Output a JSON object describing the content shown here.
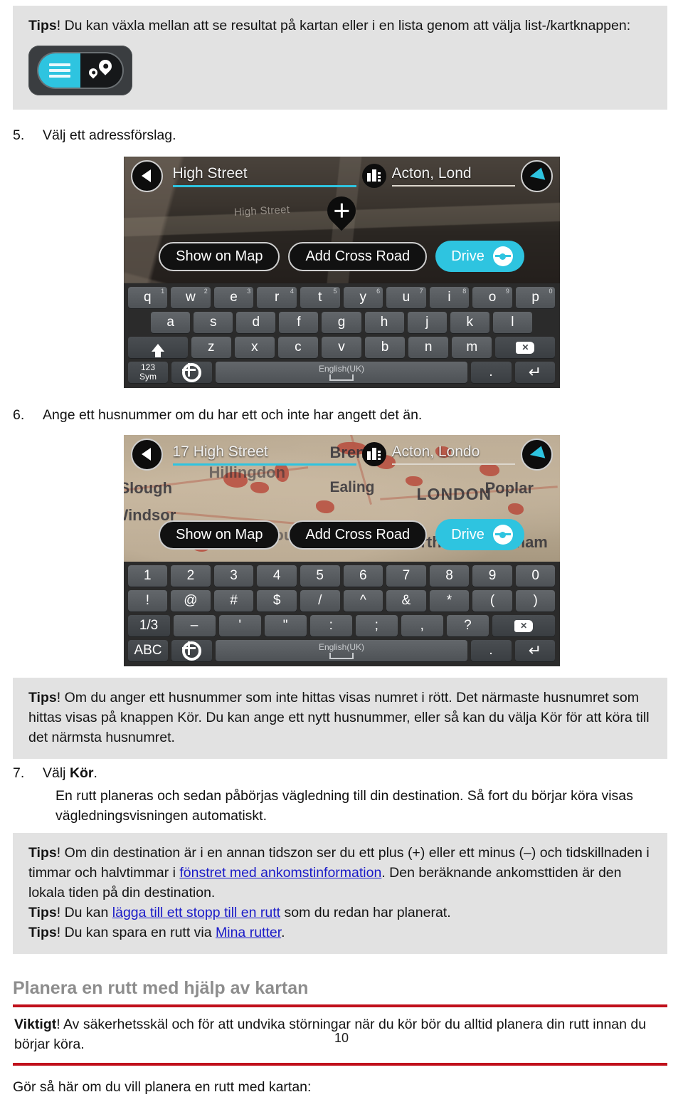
{
  "tip_top": {
    "label": "Tips",
    "text": "! Du kan växla mellan att se resultat på kartan eller i en lista genom att välja list-/kartknappen:"
  },
  "steps": {
    "step5": {
      "num": "5.",
      "text": "Välj ett adressförslag."
    },
    "step6": {
      "num": "6.",
      "text": "Ange ett husnummer om du har ett och inte har angett det än."
    },
    "step7": {
      "num": "7.",
      "text_pre": "Välj ",
      "bold": "Kör",
      "text_post": "."
    }
  },
  "device1": {
    "address": "High Street",
    "city": "Acton, Lond",
    "map_label": "High Street",
    "buttons": {
      "show_on_map": "Show on Map",
      "add_cross_road": "Add Cross Road",
      "drive": "Drive"
    },
    "keyboard": {
      "row1": [
        {
          "k": "q",
          "sup": "1"
        },
        {
          "k": "w",
          "sup": "2"
        },
        {
          "k": "e",
          "sup": "3"
        },
        {
          "k": "r",
          "sup": "4"
        },
        {
          "k": "t",
          "sup": "5"
        },
        {
          "k": "y",
          "sup": "6"
        },
        {
          "k": "u",
          "sup": "7"
        },
        {
          "k": "i",
          "sup": "8"
        },
        {
          "k": "o",
          "sup": "9"
        },
        {
          "k": "p",
          "sup": "0"
        }
      ],
      "row2": [
        "a",
        "s",
        "d",
        "f",
        "g",
        "h",
        "j",
        "k",
        "l"
      ],
      "row3": [
        "z",
        "x",
        "c",
        "v",
        "b",
        "n",
        "m"
      ],
      "num_sym": "123\nSym",
      "num_label_line1": "123",
      "num_label_line2": "Sym",
      "space_label": "English(UK)",
      "period": "."
    }
  },
  "device2": {
    "address": "17 High Street",
    "city": "Acton, Londo",
    "map_labels": [
      "Brent",
      "Hillingdon",
      "Ealing",
      "LONDON",
      "Poplar",
      "Slough",
      "Windsor",
      "Hounslow",
      "Wandsworth",
      "Lewisham"
    ],
    "buttons": {
      "show_on_map": "Show on Map",
      "add_cross_road": "Add Cross Road",
      "drive": "Drive"
    },
    "keyboard": {
      "row1": [
        "1",
        "2",
        "3",
        "4",
        "5",
        "6",
        "7",
        "8",
        "9",
        "0"
      ],
      "row2": [
        "!",
        "@",
        "#",
        "$",
        "/",
        "^",
        "&",
        "*",
        "(",
        ")"
      ],
      "row3_prefix": "1/3",
      "row3": [
        "–",
        "'",
        "\"",
        ":",
        ";",
        ","
      ],
      "row3_last": "?",
      "abc": "ABC",
      "space_label": "English(UK)",
      "period": "."
    }
  },
  "tip_housenumber": {
    "label": "Tips",
    "text": "! Om du anger ett husnummer som inte hittas visas numret i rött. Det närmaste husnumret som hittas visas på knappen Kör. Du kan ange ett nytt husnummer, eller så kan du välja Kör för att köra till det närmsta husnumret."
  },
  "route_text": "En rutt planeras och sedan påbörjas vägledning till din destination. Så fort du börjar köra visas vägledningsvisningen automatiskt.",
  "tips_block": {
    "tip1": {
      "label": "Tips",
      "part1": "! Om din destination är i en annan tidszon ser du ett plus (+) eller ett minus (–) och tidskillnaden i timmar och halvtimmar i ",
      "link": "fönstret med ankomstinformation",
      "part2": ". Den beräknande ankomsttiden är den lokala tiden på din destination."
    },
    "tip2": {
      "label": "Tips",
      "part1": "! Du kan ",
      "link": "lägga till ett stopp till en rutt",
      "part2": " som du redan har planerat."
    },
    "tip3": {
      "label": "Tips",
      "part1": "! Du kan spara en rutt via ",
      "link": "Mina rutter",
      "part2": "."
    }
  },
  "section": {
    "heading": "Planera en rutt med hjälp av kartan",
    "important_label": "Viktigt",
    "important_text": "! Av säkerhetsskäl och för att undvika störningar när du kör bör du alltid planera din rutt innan du börjar köra.",
    "howto": "Gör så här om du vill planera en rutt med kartan:"
  },
  "page_number": "10",
  "colors": {
    "accent_cyan": "#2ec4e0",
    "rule_red": "#c0101b",
    "link_blue": "#1a1ac8",
    "tip_bg": "#e2e2e2",
    "heading_gray": "#8d8d8d"
  }
}
